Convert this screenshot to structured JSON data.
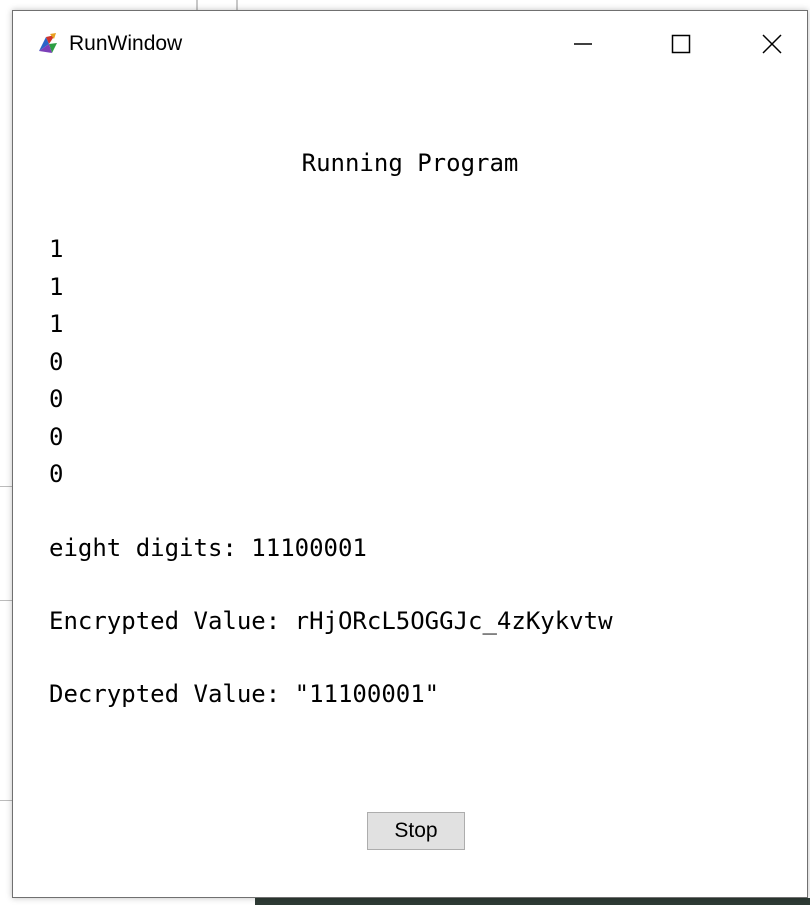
{
  "window": {
    "title": "RunWindow"
  },
  "heading": "Running Program",
  "output_lines": [
    "1",
    "1",
    "1",
    "0",
    "0",
    "0",
    "0"
  ],
  "summary": {
    "eight_digits": "eight digits: 11100001",
    "encrypted": "Encrypted Value: rHjORcL5OGGJc_4zKykvtw",
    "decrypted": "Decrypted Value: \"11100001\""
  },
  "buttons": {
    "stop_label": "Stop"
  },
  "icons": {
    "app": "app-icon",
    "minimize": "minimize-icon",
    "maximize": "maximize-icon",
    "close": "close-icon"
  }
}
